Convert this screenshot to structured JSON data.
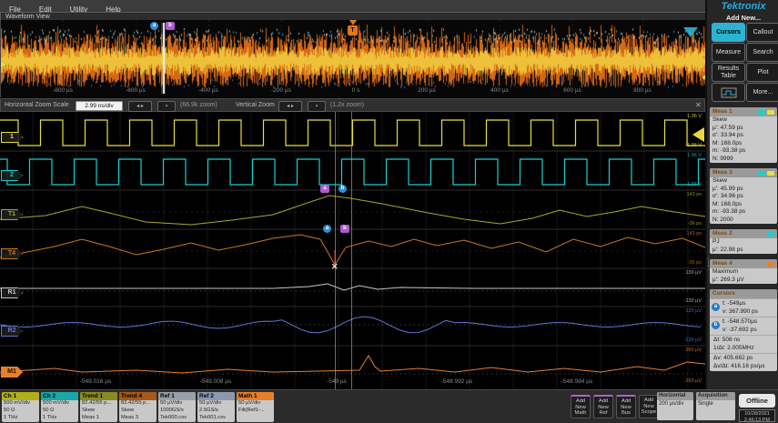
{
  "menu": {
    "items": [
      "File",
      "Edit",
      "Utility",
      "Help"
    ]
  },
  "waveform_view": {
    "title": "Waveform View"
  },
  "overview": {
    "axis": [
      "-800 µs",
      "-600 µs",
      "-400 µs",
      "-200 µs",
      "0 s",
      "200 µs",
      "400 µs",
      "600 µs",
      "800 µs"
    ],
    "trigger_label": "T",
    "cursor_a": "a",
    "cursor_b": "b"
  },
  "zoom_toolbar": {
    "h_label": "Horizontal Zoom Scale",
    "h_value": "2.99 ns/div",
    "h_zoom": "(66.9k zoom)",
    "v_label": "Vertical Zoom",
    "v_zoom": "(1.2x zoom)",
    "close": "✕"
  },
  "main_view": {
    "channels": [
      {
        "label": "1",
        "color": "#e8e040"
      },
      {
        "label": "2",
        "color": "#1ad0d0"
      },
      {
        "label": "T1",
        "color": "#a8a828"
      },
      {
        "label": "T4",
        "color": "#c87820"
      },
      {
        "label": "R1",
        "color": "#c8c8c8"
      },
      {
        "label": "R2",
        "color": "#6078d8"
      },
      {
        "label": "M1",
        "color": "#e88028"
      }
    ],
    "scales": [
      {
        "top": "1.36 V",
        "bottom": "-1.36 V"
      },
      {
        "top": "1.36 V",
        "bottom": "-1.36 V"
      },
      {
        "top": "143 ps",
        "bottom": "-36 ps"
      },
      {
        "top": "143 ps",
        "bottom": "-36 ps"
      },
      {
        "top": "130 µV",
        "bottom": "-130 µV"
      },
      {
        "top": "130 µV",
        "bottom": "-130 µV"
      },
      {
        "top": "260 µV",
        "bottom": "-260 µV"
      }
    ],
    "axis": [
      "-549.016 µs",
      "-549.008 µs",
      "-549 µs",
      "-548.992 µs",
      "-548.984 µs"
    ],
    "cursor_a": "a",
    "cursor_b": "b"
  },
  "sidebar": {
    "brand": "Tektronix",
    "add_new": "Add New...",
    "buttons": [
      {
        "label": "Cursors",
        "active": true
      },
      {
        "label": "Callout",
        "active": false
      },
      {
        "label": "Measure",
        "active": false
      },
      {
        "label": "Search",
        "active": false
      },
      {
        "label": "Results Table",
        "active": false
      },
      {
        "label": "Plot",
        "active": false
      },
      {
        "label": "",
        "icon": "scope-thumbnail-icon",
        "active": false
      },
      {
        "label": "More...",
        "active": false
      }
    ],
    "meas": [
      {
        "name": "Meas 1",
        "chips": [
          "#e8e040",
          "#1ad0d0"
        ],
        "lines": [
          "Skew",
          "µ': 47.59 ps",
          "σ': 33.94 ps",
          "M: 168.0ps",
          "m: -93.38 ps",
          "N: 9999"
        ]
      },
      {
        "name": "Meas 3",
        "chips": [
          "#e8e040",
          "#1ad0d0"
        ],
        "lines": [
          "Skew",
          "µ': 45.99 ps",
          "σ': 34.96 ps",
          "M: 168.0ps",
          "m: -93.38 ps",
          "N: 2000"
        ]
      },
      {
        "name": "Meas 2",
        "chips": [
          "#1ad0d0"
        ],
        "lines": [
          "PJ",
          "µ': 22.98 ps"
        ]
      },
      {
        "name": "Meas 4",
        "chips": [
          "#e88028"
        ],
        "lines": [
          "Maximum",
          "µ': 269.3 µV"
        ]
      }
    ],
    "cursors_panel": {
      "title": "Cursors",
      "a_label": "a",
      "a_lines": [
        "t: -549µs",
        "v: 367.990 ps"
      ],
      "b_label": "b",
      "b_lines": [
        "t: -548.570µs",
        "v: -37.692 ps"
      ],
      "delta1": [
        "Δt: 508 ns",
        "1/Δt: 2.005MHz"
      ],
      "delta2": [
        "Δv: 405.682 ps",
        "Δv/Δt: 416.16 ps/µs"
      ]
    }
  },
  "bottom_bar": {
    "badges": [
      {
        "name": "Ch 1",
        "hd": "#b0b018",
        "lines": [
          "500 mV/div",
          "50 Ω",
          "1 THz"
        ]
      },
      {
        "name": "Ch 2",
        "hd": "#18a8a8",
        "lines": [
          "500 mV/div",
          "50 Ω",
          "1 THz"
        ]
      },
      {
        "name": "Trend 1",
        "hd": "#8a8a20",
        "lines": [
          "82.42/55 p...",
          "Skew",
          "Meas 1"
        ]
      },
      {
        "name": "Trend 4",
        "hd": "#a85818",
        "lines": [
          "82.42/55 p...",
          "Skew",
          "Meas 3"
        ]
      },
      {
        "name": "Ref 1",
        "hd": "#9aa0a8",
        "lines": [
          "50 µV/div",
          "1000GS/s",
          "Tek000.csv"
        ]
      },
      {
        "name": "Ref 2",
        "hd": "#8a98b0",
        "lines": [
          "50 µV/div",
          "2.5GS/s",
          "Tek001.csv"
        ]
      },
      {
        "name": "Math 1",
        "hd": "#e88028",
        "lines": [
          "50 µV/div",
          "Filt(Ref1-..."
        ]
      }
    ],
    "add_buttons": [
      "Add New Math",
      "Add New Ref",
      "Add New Bus",
      "Add New Scope"
    ],
    "horizontal": {
      "label": "Horizontal",
      "value": "200 µs/div"
    },
    "acquisition": {
      "label": "Acquisition",
      "value": "Single"
    },
    "offline": "Offline",
    "datetime": [
      "10/28/2021",
      "2:46:13 PM"
    ]
  }
}
